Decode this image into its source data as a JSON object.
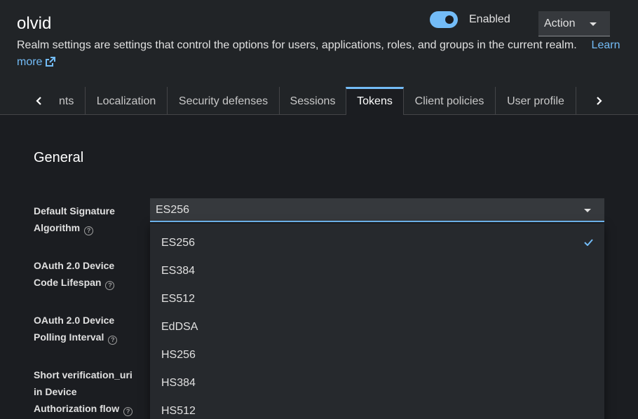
{
  "header": {
    "realm_name": "olvid",
    "enabled_label": "Enabled",
    "action_label": "Action",
    "description": "Realm settings are settings that control the options for users, applications, roles, and groups in the current realm.",
    "learn_more_line1": "Learn",
    "learn_more_line2": "more"
  },
  "tabs": [
    {
      "label": "nts"
    },
    {
      "label": "Localization"
    },
    {
      "label": "Security defenses"
    },
    {
      "label": "Sessions"
    },
    {
      "label": "Tokens",
      "active": true
    },
    {
      "label": "Client policies"
    },
    {
      "label": "User profile"
    }
  ],
  "general": {
    "title": "General",
    "fields": [
      {
        "label_line1": "Default Signature",
        "label_line2": "Algorithm"
      },
      {
        "label_line1": "OAuth 2.0 Device",
        "label_line2": "Code Lifespan"
      },
      {
        "label_line1": "OAuth 2.0 Device",
        "label_line2": "Polling Interval"
      },
      {
        "label_line1": "Short verification_uri",
        "label_line2": "in Device",
        "label_line3": "Authorization flow"
      }
    ],
    "signature_select": {
      "selected": "ES256",
      "options": [
        "ES256",
        "ES384",
        "ES512",
        "EdDSA",
        "HS256",
        "HS384",
        "HS512"
      ]
    }
  },
  "colors": {
    "accent": "#73bcf7",
    "background": "#1b1d21",
    "header_background": "#212427"
  },
  "icons": [
    "external-link-icon",
    "help-icon",
    "chevron-left-icon",
    "chevron-right-icon",
    "caret-down-icon",
    "check-icon"
  ]
}
